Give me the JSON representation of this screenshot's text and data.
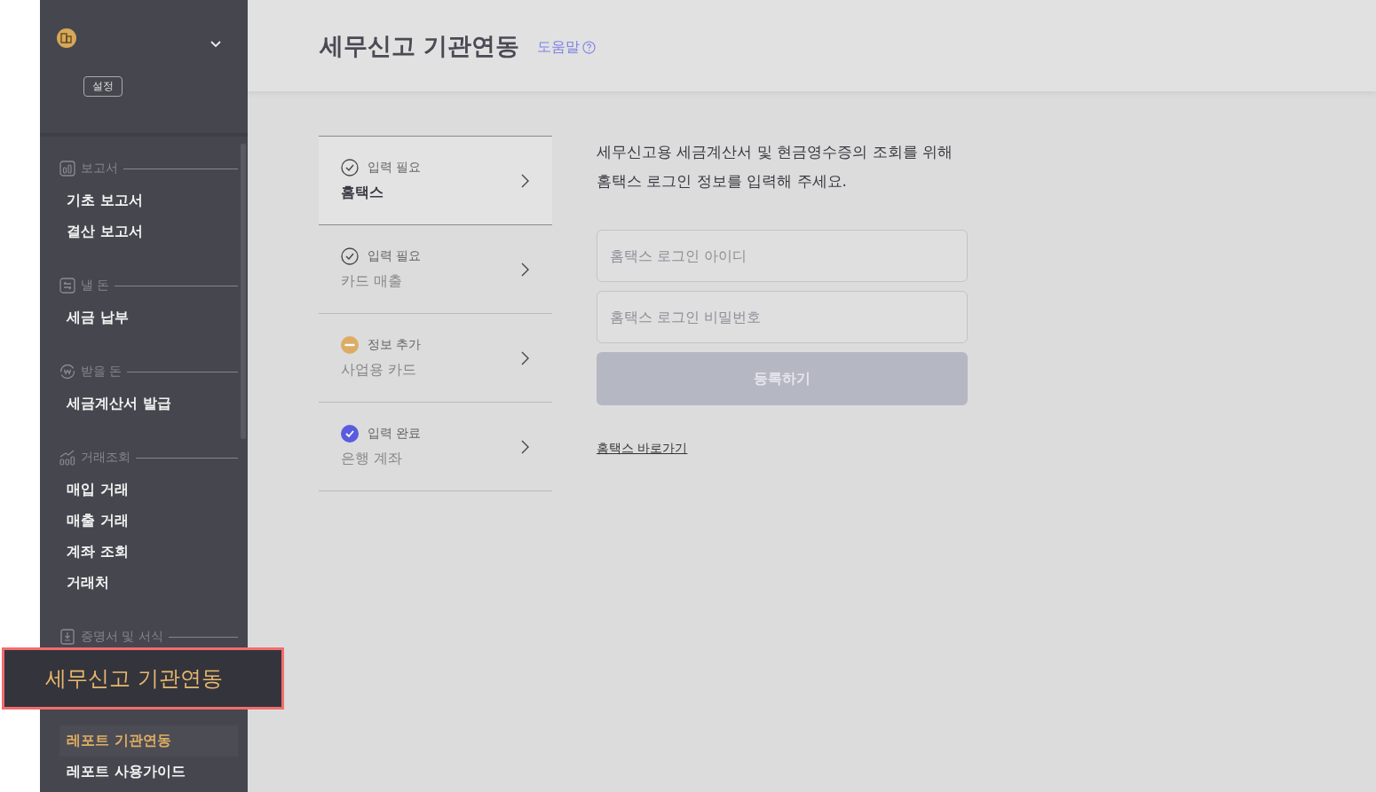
{
  "sidebar": {
    "settings_button": "설정",
    "sections": [
      {
        "title": "보고서",
        "items": [
          {
            "label": "기초 보고서",
            "selected": false
          },
          {
            "label": "결산 보고서",
            "selected": false
          }
        ]
      },
      {
        "title": "낼 돈",
        "items": [
          {
            "label": "세금 납부",
            "selected": false
          }
        ]
      },
      {
        "title": "받을 돈",
        "items": [
          {
            "label": "세금계산서 발급",
            "selected": false
          }
        ]
      },
      {
        "title": "거래조회",
        "items": [
          {
            "label": "매입 거래",
            "selected": false
          },
          {
            "label": "매출 거래",
            "selected": false
          },
          {
            "label": "계좌 조회",
            "selected": false
          },
          {
            "label": "거래처",
            "selected": false
          }
        ]
      },
      {
        "title": "증명서 및 서식",
        "items": [
          {
            "label": "레포트 기관연동",
            "selected": true
          },
          {
            "label": "레포트 사용가이드",
            "selected": false
          }
        ]
      }
    ]
  },
  "callout": {
    "label": "세무신고 기관연동"
  },
  "header": {
    "title": "세무신고 기관연동",
    "help": "도움말"
  },
  "steps": [
    {
      "kind": "required",
      "status": "입력 필요",
      "title": "홈택스",
      "selected": true
    },
    {
      "kind": "required",
      "status": "입력 필요",
      "title": "카드 매출",
      "selected": false
    },
    {
      "kind": "add",
      "status": "정보 추가",
      "title": "사업용 카드",
      "selected": false
    },
    {
      "kind": "done",
      "status": "입력 완료",
      "title": "은행 계좌",
      "selected": false
    }
  ],
  "form": {
    "description_lines": [
      "세무신고용 세금계산서 및 현금영수증의 조회를 위해",
      "홈택스 로그인 정보를 입력해 주세요."
    ],
    "fields": [
      {
        "placeholder": "홈택스 로그인 아이디"
      },
      {
        "placeholder": "홈택스 로그인 비밀번호"
      }
    ],
    "submit": {
      "label": "등록하기",
      "disabled": true
    },
    "link": "홈택스 바로가기"
  }
}
